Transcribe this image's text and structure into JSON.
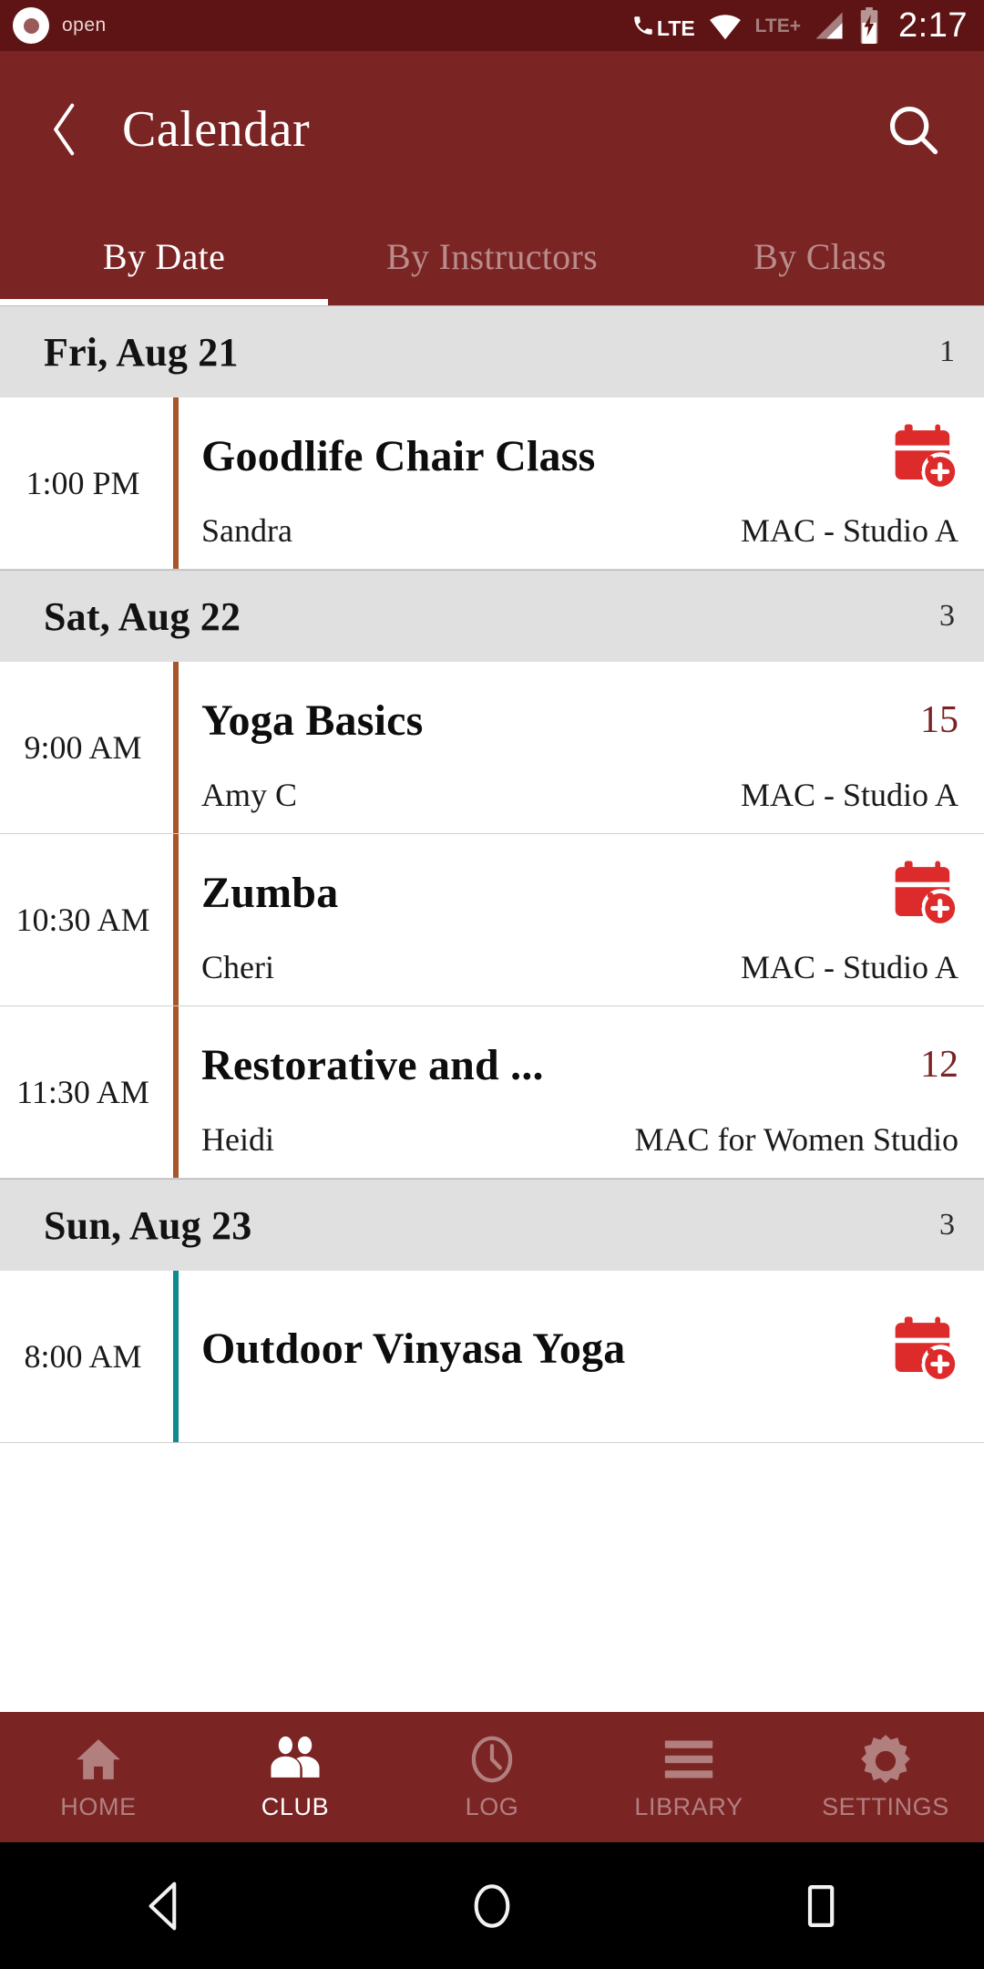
{
  "status_bar": {
    "notification_label": "open",
    "notification_icon": "record-circle-icon",
    "icons": [
      "phone-lte-icon",
      "wifi-icon",
      "lte-plus-icon",
      "signal-bars-icon",
      "battery-charging-icon"
    ],
    "lte_label": "LTE",
    "lte_plus_label": "LTE+",
    "clock": "2:17"
  },
  "app_bar": {
    "back_icon": "chevron-left-icon",
    "title": "Calendar",
    "search_icon": "search-icon"
  },
  "tabs": {
    "active_index": 0,
    "items": [
      {
        "label": "By Date"
      },
      {
        "label": "By Instructors"
      },
      {
        "label": "By Class"
      }
    ]
  },
  "colors": {
    "status_bar": "#5e1414",
    "primary": "#7b2424",
    "day_header_bg": "#e0e0e0",
    "accent_bar": "#a8552b",
    "accent_bar_alt": "#0f8a8f",
    "add_icon": "#dd2b2b",
    "count_text": "#7b2424"
  },
  "schedule": [
    {
      "date_label": "Fri, Aug 21",
      "count": "1",
      "events": [
        {
          "time": "1:00 PM",
          "title": "Goodlife Chair Class",
          "instructor": "Sandra",
          "location": "MAC - Studio A",
          "accent": "orange",
          "action": "add-to-calendar-icon",
          "spots": null
        }
      ]
    },
    {
      "date_label": "Sat, Aug 22",
      "count": "3",
      "events": [
        {
          "time": "9:00 AM",
          "title": "Yoga Basics",
          "instructor": "Amy C",
          "location": "MAC - Studio A",
          "accent": "orange",
          "action": null,
          "spots": "15"
        },
        {
          "time": "10:30 AM",
          "title": "Zumba",
          "instructor": "Cheri",
          "location": "MAC - Studio A",
          "accent": "orange",
          "action": "add-to-calendar-icon",
          "spots": null
        },
        {
          "time": "11:30 AM",
          "title": "Restorative and ...",
          "instructor": "Heidi",
          "location": "MAC for Women Studio",
          "accent": "orange",
          "action": null,
          "spots": "12"
        }
      ]
    },
    {
      "date_label": "Sun, Aug 23",
      "count": "3",
      "events": [
        {
          "time": "8:00 AM",
          "title": "Outdoor Vinyasa Yoga",
          "instructor": "",
          "location": "",
          "accent": "teal",
          "action": "add-to-calendar-icon",
          "spots": null
        }
      ]
    }
  ],
  "bottom_nav": {
    "active_index": 1,
    "items": [
      {
        "label": "HOME",
        "icon": "home-icon"
      },
      {
        "label": "CLUB",
        "icon": "people-icon"
      },
      {
        "label": "LOG",
        "icon": "clock-icon"
      },
      {
        "label": "LIBRARY",
        "icon": "list-icon"
      },
      {
        "label": "SETTINGS",
        "icon": "gear-icon"
      }
    ]
  },
  "android_nav": {
    "back_icon": "triangle-back-icon",
    "home_icon": "circle-home-icon",
    "recents_icon": "square-recents-icon"
  }
}
